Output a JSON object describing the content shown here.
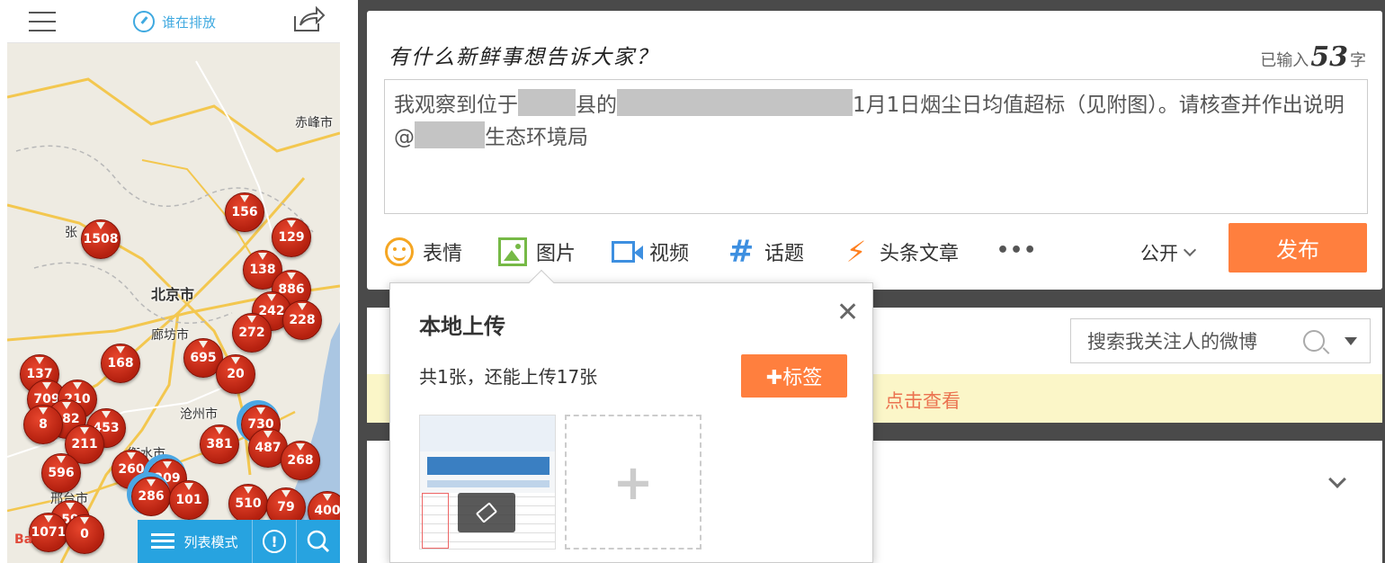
{
  "phone": {
    "app_name": "谁在排放",
    "list_mode_label": "列表模式",
    "info_button_glyph": "!",
    "baidu_watermark": "Ba",
    "cities": [
      {
        "name": "赤峰市"
      },
      {
        "name": "北京市"
      },
      {
        "name": "廊坊市"
      },
      {
        "name": "张"
      },
      {
        "name": "沧州市"
      },
      {
        "name": "邢台市"
      },
      {
        "name": "衡水市"
      }
    ],
    "markers": [
      "156",
      "129",
      "1508",
      "138",
      "886",
      "242",
      "228",
      "272",
      "695",
      "168",
      "20",
      "137",
      "709",
      "210",
      "182",
      "453",
      "8",
      "730",
      "211",
      "381",
      "487",
      "268",
      "260",
      "209",
      "596",
      "286",
      "101",
      "510",
      "79",
      "400",
      "59",
      "1071",
      "0"
    ]
  },
  "compose": {
    "prompt": "有什么新鲜事想告诉大家？",
    "counter_prefix": "已输入",
    "counter_value": "53",
    "counter_suffix": "字",
    "text_1": "我观察到位于",
    "text_2": "县的",
    "text_3": "1月1日烟尘日均值超标（见附图）。请核查并作出说明@",
    "text_4": "生态环境局",
    "toolbar": {
      "emoji": "表情",
      "image": "图片",
      "video": "视频",
      "topic": "话题",
      "article": "头条文章",
      "more": "•••",
      "visibility": "公开",
      "publish": "发布"
    }
  },
  "feed": {
    "search_placeholder": "搜索我关注人的微博",
    "notice_link": "点击查看"
  },
  "upload": {
    "title": "本地上传",
    "close": "✕",
    "count_text": "共1张，还能上传17张",
    "tag_button": "✚标签",
    "add_glyph": "+"
  }
}
